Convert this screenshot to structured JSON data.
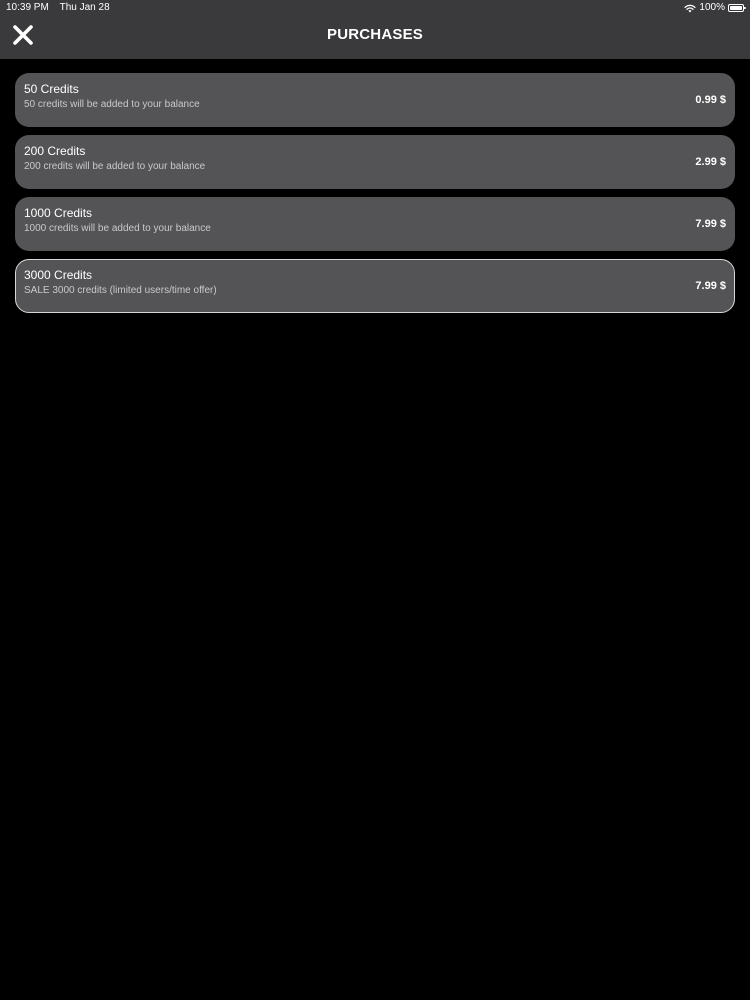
{
  "status_bar": {
    "time": "10:39 PM",
    "date": "Thu Jan 28",
    "battery_text": "100%",
    "battery_level": 1.0
  },
  "header": {
    "title": "PURCHASES",
    "close_icon": "close-icon"
  },
  "purchases": [
    {
      "title": "50 Credits",
      "description": "50 credits will be added to your balance",
      "price": "0.99 $",
      "selected": false
    },
    {
      "title": "200 Credits",
      "description": "200 credits will be added to your balance",
      "price": "2.99 $",
      "selected": false
    },
    {
      "title": "1000 Credits",
      "description": "1000 credits will be added to your balance",
      "price": "7.99 $",
      "selected": false
    },
    {
      "title": "3000 Credits",
      "description": "SALE 3000 credits (limited users/time offer)",
      "price": "7.99 $",
      "selected": true
    }
  ],
  "colors": {
    "background": "#000000",
    "header": "#3a3a3c",
    "item": "#545456",
    "selected_border": "#d8d8d8"
  }
}
